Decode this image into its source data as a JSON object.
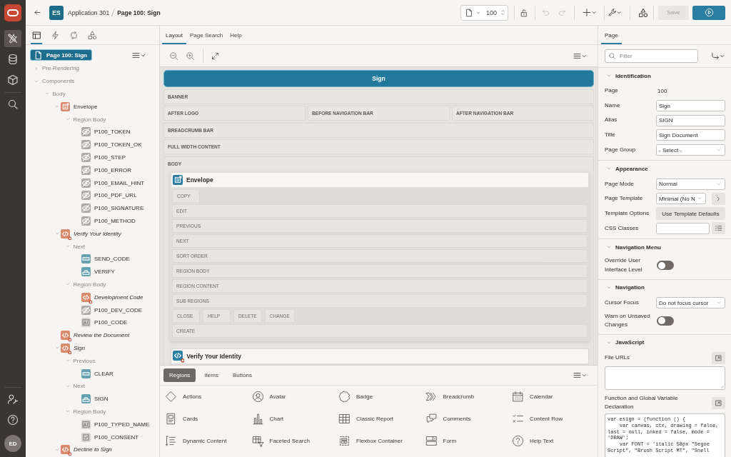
{
  "nav_rail": {
    "items": [
      {
        "selected": true
      },
      {
        "selected": false
      },
      {
        "selected": false
      },
      {
        "selected": false
      }
    ],
    "user_initials": "ED"
  },
  "app_bar": {
    "app_badge": "ES",
    "app_name": "Application 301",
    "page_name": "Page 100: Sign",
    "page_number": "100",
    "undo": {
      "disabled": true
    },
    "redo": {
      "disabled": true
    },
    "save": {
      "label": "Save",
      "disabled": true
    }
  },
  "left_panel": {
    "tabs": [
      {
        "selected": true
      },
      {
        "selected": false
      },
      {
        "selected": false
      },
      {
        "selected": false
      }
    ],
    "tree": {
      "label": "Page 100: Sign",
      "kind": "page",
      "selected": true,
      "children": [
        {
          "label": "Pre-Rendering",
          "kind": "group",
          "selected": false,
          "expanded": false
        },
        {
          "label": "Components",
          "kind": "group",
          "selected": false,
          "expanded": true,
          "children": [
            {
              "label": "Body",
              "kind": "group",
              "selected": false,
              "expanded": true,
              "children": [
                {
                  "label": "Envelope",
                  "kind": "static-region",
                  "conditional": false,
                  "selected": false,
                  "expanded": true,
                  "children": [
                    {
                      "label": "Region Body",
                      "kind": "group",
                      "selected": false,
                      "expanded": true,
                      "children": [
                        {
                          "label": "P100_TOKEN",
                          "kind": "hidden-item",
                          "selected": false
                        },
                        {
                          "label": "P100_TOKEN_OK",
                          "kind": "hidden-item",
                          "selected": false
                        },
                        {
                          "label": "P100_STEP",
                          "kind": "hidden-item",
                          "selected": false
                        },
                        {
                          "label": "P100_ERROR",
                          "kind": "hidden-item",
                          "selected": false
                        },
                        {
                          "label": "P100_EMAIL_HINT",
                          "kind": "hidden-item",
                          "selected": false
                        },
                        {
                          "label": "P100_PDF_URL",
                          "kind": "hidden-item",
                          "selected": false
                        },
                        {
                          "label": "P100_SIGNATURE",
                          "kind": "hidden-item",
                          "selected": false
                        },
                        {
                          "label": "P100_METHOD",
                          "kind": "hidden-item",
                          "selected": false
                        }
                      ]
                    }
                  ]
                },
                {
                  "label": "Verify Your Identity",
                  "kind": "code-region",
                  "conditional": true,
                  "selected": false,
                  "expanded": true,
                  "children": [
                    {
                      "label": "Next",
                      "kind": "group",
                      "selected": false,
                      "expanded": true,
                      "children": [
                        {
                          "label": "SEND_CODE",
                          "kind": "button",
                          "selected": false
                        },
                        {
                          "label": "VERIFY",
                          "kind": "hot-button",
                          "selected": false
                        }
                      ]
                    },
                    {
                      "label": "Region Body",
                      "kind": "group",
                      "selected": false,
                      "expanded": true,
                      "children": [
                        {
                          "label": "Development Code",
                          "kind": "code-region",
                          "conditional": true,
                          "selected": false
                        },
                        {
                          "label": "P100_DEV_CODE",
                          "kind": "hidden-item",
                          "selected": false
                        },
                        {
                          "label": "P100_CODE",
                          "kind": "text-item",
                          "selected": false
                        }
                      ]
                    }
                  ]
                },
                {
                  "label": "Review the Document",
                  "kind": "code-region",
                  "conditional": true,
                  "selected": false
                },
                {
                  "label": "Sign",
                  "kind": "code-region",
                  "conditional": true,
                  "selected": false,
                  "expanded": true,
                  "children": [
                    {
                      "label": "Previous",
                      "kind": "group",
                      "selected": false,
                      "expanded": true,
                      "children": [
                        {
                          "label": "CLEAR",
                          "kind": "button",
                          "selected": false
                        }
                      ]
                    },
                    {
                      "label": "Next",
                      "kind": "group",
                      "selected": false,
                      "expanded": true,
                      "children": [
                        {
                          "label": "SIGN",
                          "kind": "hot-button",
                          "selected": false
                        }
                      ]
                    },
                    {
                      "label": "Region Body",
                      "kind": "group",
                      "selected": false,
                      "expanded": true,
                      "children": [
                        {
                          "label": "P100_TYPED_NAME",
                          "kind": "text-item",
                          "selected": false
                        },
                        {
                          "label": "P100_CONSENT",
                          "kind": "checkbox-item",
                          "selected": false
                        }
                      ]
                    }
                  ]
                },
                {
                  "label": "Decline to Sign",
                  "kind": "code-region",
                  "conditional": true,
                  "selected": false,
                  "expanded": true
                }
              ]
            }
          ]
        }
      ]
    }
  },
  "layout_editor": {
    "tabs": [
      {
        "label": "Layout",
        "selected": true
      },
      {
        "label": "Page Search",
        "selected": false
      },
      {
        "label": "Help",
        "selected": false
      }
    ],
    "page_bar": "Sign",
    "positions": [
      [
        "BANNER"
      ],
      [
        "AFTER LOGO",
        "BEFORE NAVIGATION BAR",
        "AFTER NAVIGATION BAR"
      ],
      [
        "BREADCRUMB BAR"
      ],
      [
        "FULL WIDTH CONTENT"
      ]
    ],
    "body_label": "BODY",
    "regions": [
      {
        "title": "Envelope",
        "kind": "static-region",
        "conditional": false,
        "slot_rows": [
          {
            "kind": "inline",
            "slots": [
              "COPY"
            ]
          },
          {
            "kind": "full",
            "slots": [
              "EDIT"
            ]
          },
          {
            "kind": "full",
            "slots": [
              "PREVIOUS"
            ]
          },
          {
            "kind": "full",
            "slots": [
              "NEXT"
            ]
          },
          {
            "kind": "full",
            "slots": [
              "SORT ORDER"
            ]
          },
          {
            "kind": "full",
            "slots": [
              "REGION BODY"
            ]
          },
          {
            "kind": "full",
            "slots": [
              "REGION CONTENT"
            ]
          },
          {
            "kind": "full",
            "slots": [
              "SUB REGIONS"
            ]
          },
          {
            "kind": "inline",
            "slots": [
              "CLOSE",
              "HELP",
              "DELETE",
              "CHANGE"
            ]
          },
          {
            "kind": "full",
            "slots": [
              "CREATE"
            ]
          }
        ]
      },
      {
        "title": "Verify Your Identity",
        "kind": "code-region",
        "conditional": true
      }
    ]
  },
  "gallery": {
    "tabs": [
      {
        "label": "Regions",
        "selected": true
      },
      {
        "label": "Items",
        "selected": false
      },
      {
        "label": "Buttons",
        "selected": false
      }
    ],
    "items": [
      "Actions",
      "Avatar",
      "Badge",
      "Breadcrumb",
      "Calendar",
      "Cards",
      "Chart",
      "Classic Report",
      "Comments",
      "Content Row",
      "Dynamic Content",
      "Faceted Search",
      "Flexbox Container",
      "Form",
      "Help Text"
    ]
  },
  "property_editor": {
    "tabs": [
      {
        "label": "Page",
        "selected": true
      }
    ],
    "filter_placeholder": "Filter",
    "sections": [
      {
        "title": "Identification",
        "expanded": true,
        "rows": [
          {
            "label": "Page",
            "kind": "static",
            "value": "100"
          },
          {
            "label": "Name",
            "kind": "text",
            "value": "Sign"
          },
          {
            "label": "Alias",
            "kind": "text",
            "value": "SIGN"
          },
          {
            "label": "Title",
            "kind": "text",
            "value": "Sign Document"
          },
          {
            "label": "Page Group",
            "kind": "select",
            "value": "- Select -"
          }
        ]
      },
      {
        "title": "Appearance",
        "expanded": true,
        "rows": [
          {
            "label": "Page Mode",
            "kind": "select",
            "value": "Normal"
          },
          {
            "label": "Page Template",
            "kind": "select-link",
            "value": "Minimal (No N"
          },
          {
            "label": "Template Options",
            "kind": "button",
            "value": "Use Template Defaults"
          },
          {
            "label": "CSS Classes",
            "kind": "text-list"
          }
        ]
      },
      {
        "title": "Navigation Menu",
        "expanded": true,
        "rows": [
          {
            "label": "Override User Interface Level",
            "kind": "switch",
            "on": false
          }
        ]
      },
      {
        "title": "Navigation",
        "expanded": true,
        "rows": [
          {
            "label": "Cursor Focus",
            "kind": "select",
            "value": "Do not focus cursor"
          },
          {
            "label": "Warn on Unsaved Changes",
            "kind": "switch",
            "on": false
          }
        ]
      },
      {
        "title": "JavaScript",
        "expanded": true,
        "rows": [
          {
            "label": "File URLs",
            "kind": "textarea"
          },
          {
            "label": "Function and Global Variable Declaration",
            "kind": "code",
            "value": "var esign = (function () {\n    var canvas, ctx, drawing = false, last = null, inked = false, mode = 'DRAW';\n    var FONT = 'italic 58px \"Segoe Script\", \"Brush Script MT\", \"Snell"
          }
        ]
      }
    ]
  }
}
